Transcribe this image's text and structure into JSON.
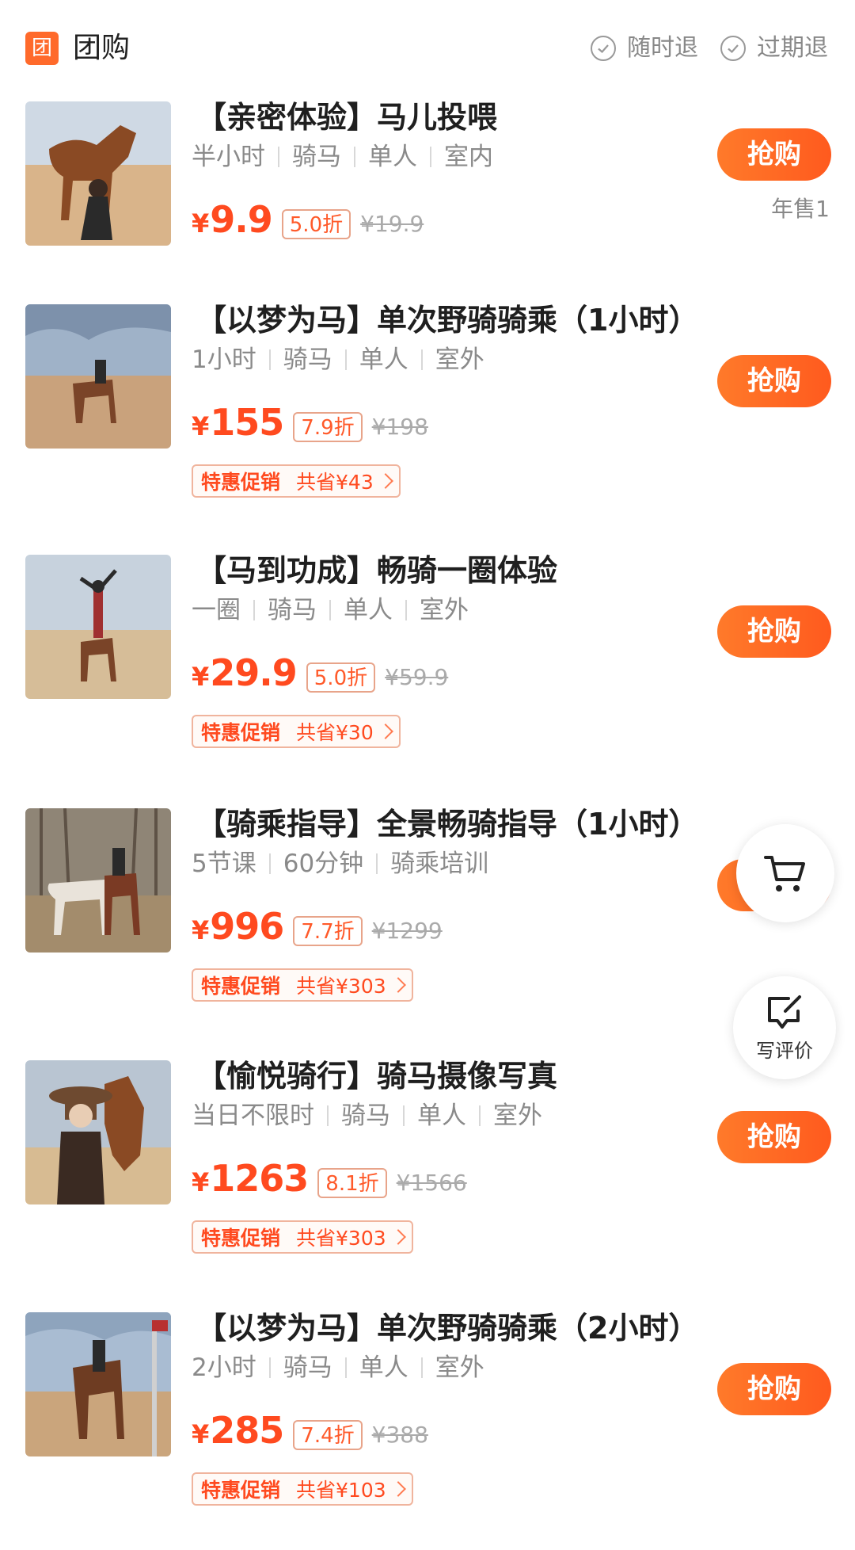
{
  "header": {
    "badge": "团",
    "title": "团购",
    "policies": [
      "随时退",
      "过期退"
    ]
  },
  "deals": [
    {
      "title": "【亲密体验】马儿投喂",
      "tags": [
        "半小时",
        "骑马",
        "单人",
        "室内"
      ],
      "price": "9.9",
      "discount": "5.0折",
      "original": "¥19.9",
      "promo": null,
      "annual_sales": "年售1",
      "button": "抢购"
    },
    {
      "title": "【以梦为马】单次野骑骑乘（1小时）",
      "tags": [
        "1小时",
        "骑马",
        "单人",
        "室外"
      ],
      "price": "155",
      "discount": "7.9折",
      "original": "¥198",
      "promo": {
        "tag": "特惠促销",
        "save": "共省¥43"
      },
      "button": "抢购"
    },
    {
      "title": "【马到功成】畅骑一圈体验",
      "tags": [
        "一圈",
        "骑马",
        "单人",
        "室外"
      ],
      "price": "29.9",
      "discount": "5.0折",
      "original": "¥59.9",
      "promo": {
        "tag": "特惠促销",
        "save": "共省¥30"
      },
      "button": "抢购"
    },
    {
      "title": "【骑乘指导】全景畅骑指导（1小时）",
      "tags": [
        "5节课",
        "60分钟",
        "骑乘培训"
      ],
      "price": "996",
      "discount": "7.7折",
      "original": "¥1299",
      "promo": {
        "tag": "特惠促销",
        "save": "共省¥303"
      },
      "button": "抢购"
    },
    {
      "title": "【愉悦骑行】骑马摄像写真",
      "tags": [
        "当日不限时",
        "骑马",
        "单人",
        "室外"
      ],
      "price": "1263",
      "discount": "8.1折",
      "original": "¥1566",
      "promo": {
        "tag": "特惠促销",
        "save": "共省¥303"
      },
      "button": "抢购"
    },
    {
      "title": "【以梦为马】单次野骑骑乘（2小时）",
      "tags": [
        "2小时",
        "骑马",
        "单人",
        "室外"
      ],
      "price": "285",
      "discount": "7.4折",
      "original": "¥388",
      "promo": {
        "tag": "特惠促销",
        "save": "共省¥103"
      },
      "button": "抢购"
    }
  ],
  "currency_symbol": "¥",
  "float": {
    "cart_icon": "cart-icon",
    "review_label": "写评价"
  },
  "colors": {
    "accent": "#ff5a1e",
    "brand_badge": "#ff6a2b",
    "price": "#ff4a1f"
  }
}
